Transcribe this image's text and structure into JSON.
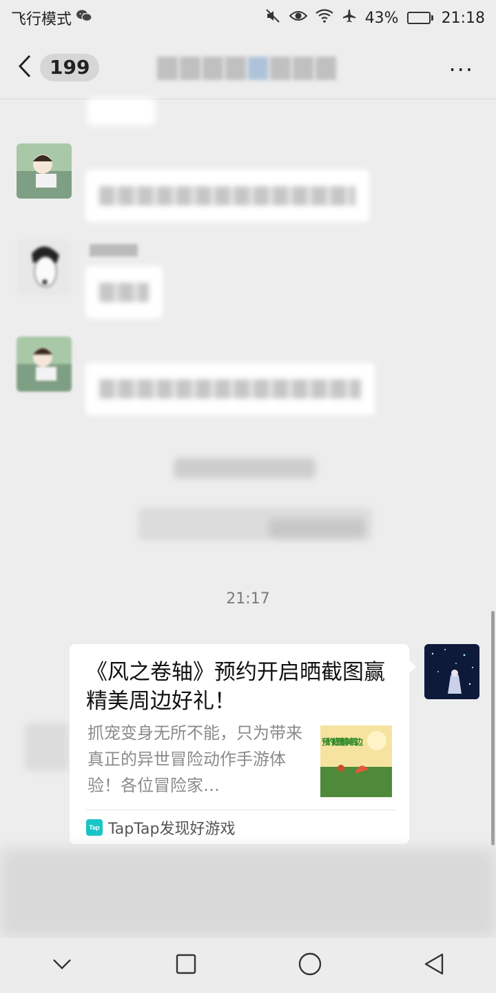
{
  "status_bar": {
    "mode_text": "飞行模式",
    "battery": "43%",
    "time": "21:18"
  },
  "header": {
    "unread_count": "199",
    "more_symbol": "···"
  },
  "messages": {
    "sender_1_name": "",
    "sender_3_name": ""
  },
  "timestamp": "21:17",
  "link_card": {
    "title": "《风之卷轴》预约开启晒截图赢精美周边好礼！",
    "description": "抓宠变身无所不能，只为带来真正的异世冒险动作手游体验！各位冒险家…",
    "source_logo_text": "Tap",
    "source": "TapTap发现好游戏",
    "thumbnail_text": "预约截图 精美周边"
  },
  "icons": {
    "wechat": "wechat-icon",
    "mute": "mute-icon",
    "eye": "eye-comfort-icon",
    "wifi": "wifi-icon",
    "airplane": "airplane-icon",
    "battery": "battery-icon",
    "back": "chevron-left-icon",
    "nav_down": "chevron-down-icon",
    "nav_recent": "square-icon",
    "nav_home": "circle-icon",
    "nav_back": "triangle-back-icon"
  },
  "colors": {
    "background": "#ededed",
    "bubble": "#ffffff",
    "taptap": "#18c5c6"
  }
}
